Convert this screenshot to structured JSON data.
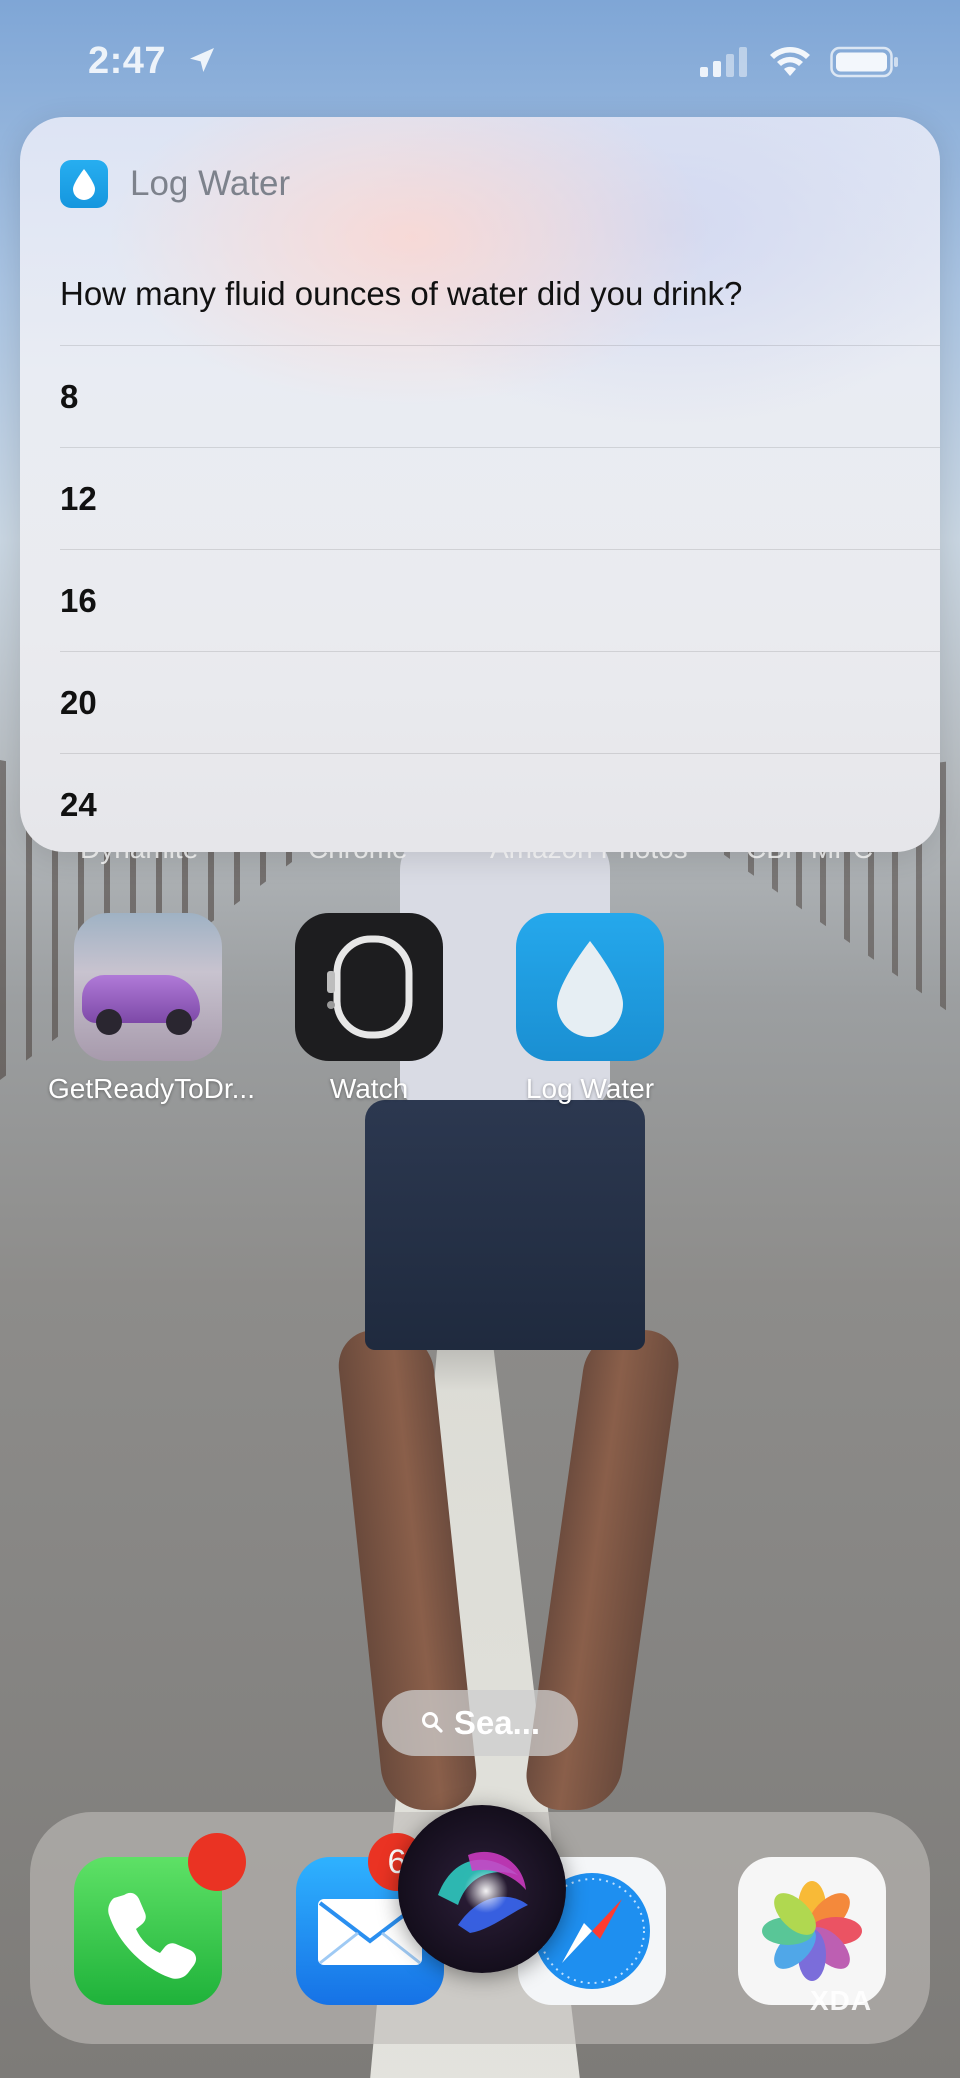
{
  "status_bar": {
    "time": "2:47",
    "icons": [
      "location-arrow-icon",
      "cellular-signal-icon",
      "wifi-icon",
      "battery-icon"
    ]
  },
  "siri_card": {
    "app_name": "Log Water",
    "app_icon": "water-drop-icon",
    "question": "How many fluid ounces of water did you drink?",
    "options": [
      "8",
      "12",
      "16",
      "20",
      "24"
    ]
  },
  "home_screen": {
    "partially_hidden_labels": [
      "Dynamite",
      "Chrome",
      "Amazon Photos",
      "CBP MPC"
    ],
    "apps": [
      {
        "label": "GetReadyToDr...",
        "icon": "car-photo-icon"
      },
      {
        "label": "Watch",
        "icon": "watch-icon"
      },
      {
        "label": "Log Water",
        "icon": "water-drop-icon"
      }
    ],
    "search_label": "Sea..."
  },
  "dock": {
    "apps": [
      {
        "name": "Phone",
        "icon": "phone-icon",
        "badge": ""
      },
      {
        "name": "Mail",
        "icon": "mail-icon",
        "badge": "6"
      },
      {
        "name": "Safari",
        "icon": "compass-icon",
        "badge": ""
      },
      {
        "name": "Photos",
        "icon": "photos-icon",
        "badge": ""
      }
    ]
  },
  "siri": {
    "icon": "siri-orb-icon"
  },
  "watermark": "XDA",
  "colors": {
    "accent_blue": "#1a8fd2",
    "badge_red": "#ea3323",
    "card_bg": "#e9ecf3"
  }
}
